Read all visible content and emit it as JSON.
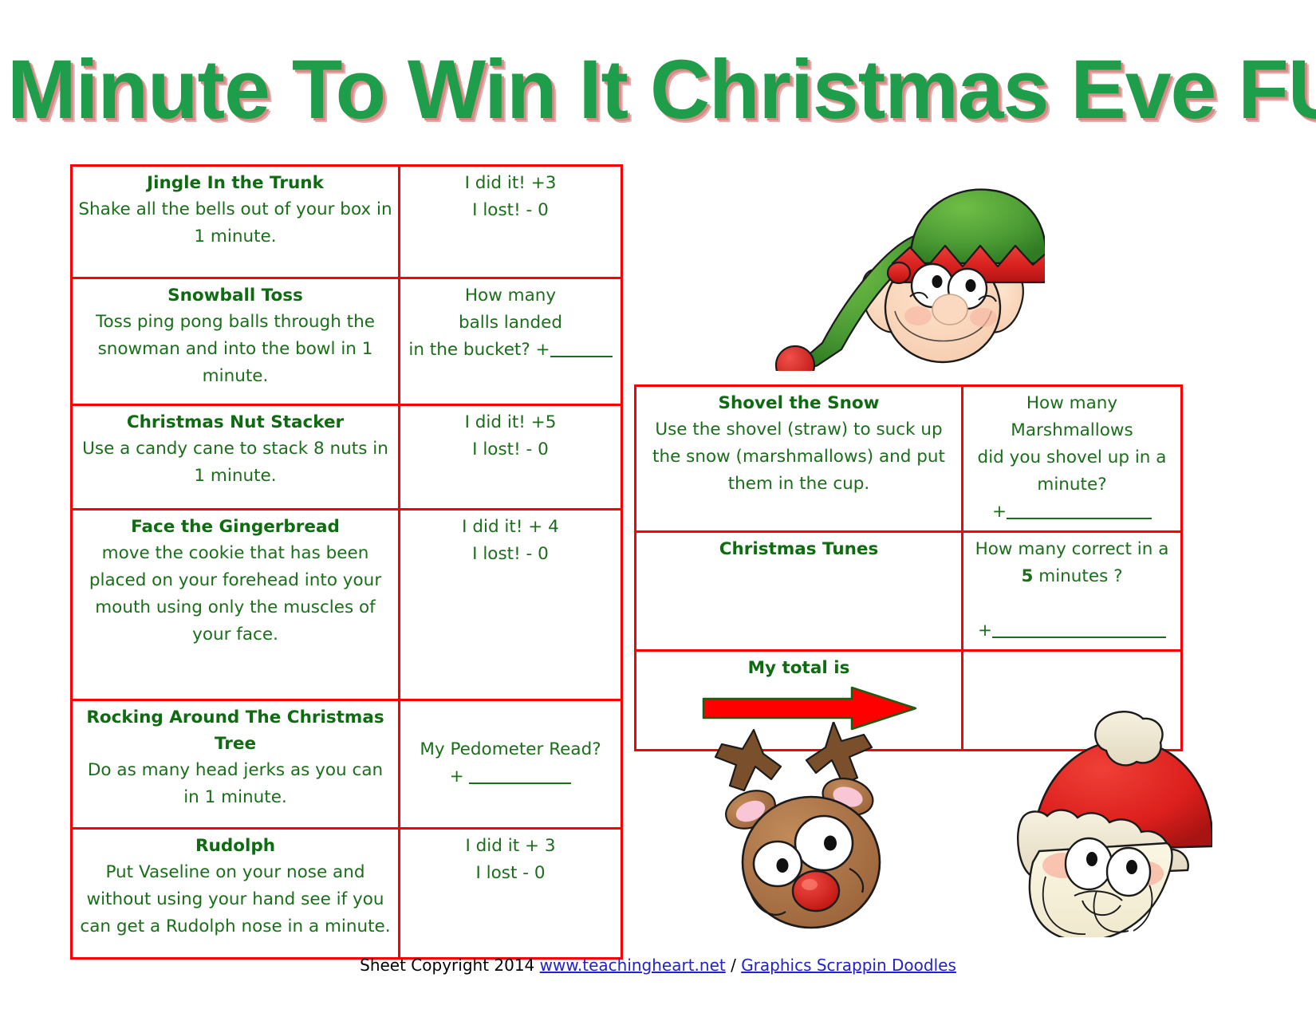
{
  "page": {
    "title": "Minute To Win It Christmas Eve FUN!",
    "title_color": "#1e9e4a",
    "title_shadow_color": "#d98a86",
    "table_border_color": "#ff0000",
    "text_color": "#1a6e1a",
    "arrow_color": "#ff0000"
  },
  "left_table": {
    "rows": [
      {
        "title": "Jingle In the Trunk",
        "description": "Shake all the bells out of your box in 1 minute.",
        "score_line1": "I did it!  +3",
        "score_line2": "I lost!  - 0"
      },
      {
        "title": "Snowball Toss",
        "description": "Toss ping pong balls through the snowman and into the bowl in 1 minute.",
        "score_line1": "How many",
        "score_line2": "balls landed",
        "score_line3": "in the bucket? +"
      },
      {
        "title": "Christmas Nut Stacker",
        "description": "Use a candy cane to stack 8 nuts in 1 minute.",
        "score_line1": "I did it!  +5",
        "score_line2": "I lost!  - 0"
      },
      {
        "title": "Face the Gingerbread",
        "description": "move the cookie that has been placed on your forehead into your mouth using only the muscles of your face.",
        "score_line1": "I did it!  + 4",
        "score_line2": "I lost! - 0"
      },
      {
        "title": "Rocking Around The Christmas Tree",
        "description": "Do as many head jerks as you can in 1 minute.",
        "score_line1": "My Pedometer Read?",
        "score_line2": "+"
      },
      {
        "title": "Rudolph",
        "description": "Put Vaseline on your nose and without using your hand see if you can get a Rudolph nose in a minute.",
        "score_line1": "I did it + 3",
        "score_line2": "I lost  - 0"
      }
    ]
  },
  "right_table": {
    "rows": [
      {
        "title": "Shovel the Snow",
        "description": "Use the shovel (straw) to suck up the snow (marshmallows) and put them in the cup.",
        "score_line1": "How many Marshmallows",
        "score_line2": "did you shovel up in a",
        "score_line3": "minute?",
        "score_line4": "+"
      },
      {
        "title": "Christmas Tunes",
        "description": "",
        "score_line1": "How many correct in a",
        "score_line2_bold": "5",
        "score_line2": " minutes ?",
        "score_line3": "+"
      },
      {
        "title": "My total is",
        "description": "",
        "score_line1": ""
      }
    ]
  },
  "clipart": [
    {
      "name": "elf-face",
      "label": "Christmas elf face with green pointed hat"
    },
    {
      "name": "reindeer-face",
      "label": "Rudolph reindeer face with red nose"
    },
    {
      "name": "santa-face",
      "label": "Santa Claus face with red hat and white beard"
    }
  ],
  "footer": {
    "copyright": "Sheet Copyright 2014 ",
    "link1": "www.teachingheart.net",
    "separator": " / ",
    "link2": "Graphics Scrappin Doodles"
  }
}
